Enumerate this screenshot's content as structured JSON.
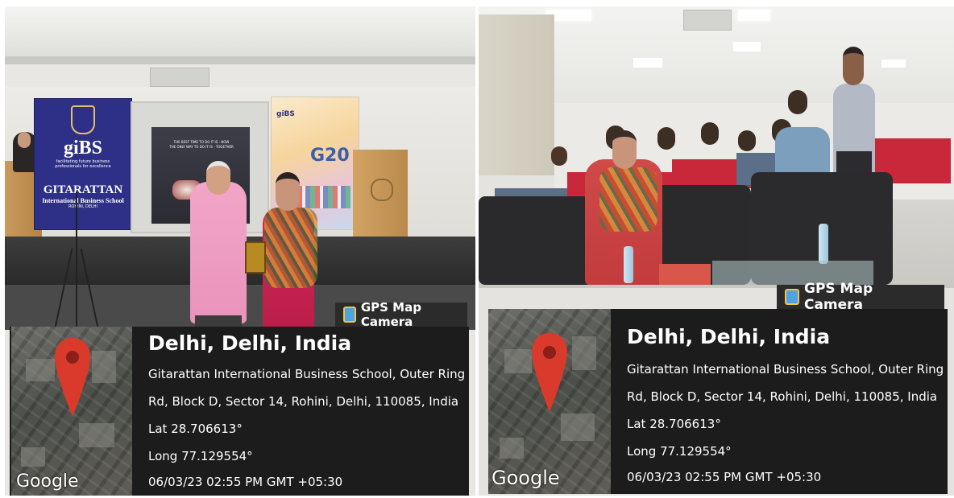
{
  "photos": [
    {
      "banner": {
        "brand": "giBS",
        "tagline": "facilitating future business professionals for excellence",
        "school": "GITARATTAN",
        "subtitle": "International Business School",
        "city": "ROHINI, DELHI"
      },
      "screen_text": "THE BEST TIME TO DO IT IS - NOW\nTHE ONLY WAY TO DO IT IS - TOGETHER",
      "poster": {
        "brand": "giBS",
        "g20": "G20"
      },
      "stamp": {
        "app_label": "GPS Map Camera",
        "map_brand": "Google",
        "location_title": "Delhi, Delhi, India",
        "address_line1": "Gitarattan International Business School, Outer Ring",
        "address_line2": "Rd, Block D, Sector 14, Rohini, Delhi, 110085, India",
        "lat": "Lat 28.706613°",
        "long": "Long 77.129554°",
        "datetime": "06/03/23 02:55 PM GMT +05:30"
      }
    },
    {
      "stamp": {
        "app_label": "GPS Map Camera",
        "map_brand": "Google",
        "location_title": "Delhi, Delhi, India",
        "address_line1": "Gitarattan International Business School, Outer Ring",
        "address_line2": "Rd, Block D, Sector 14, Rohini, Delhi, 110085, India",
        "lat": "Lat 28.706613°",
        "long": "Long 77.129554°",
        "datetime": "06/03/23 02:55 PM GMT +05:30"
      }
    }
  ],
  "colors": {
    "pin": "#d93a2b",
    "banner": "#2e2f86",
    "chair_red": "#c8283a",
    "sofa": "#2a2a2c"
  }
}
